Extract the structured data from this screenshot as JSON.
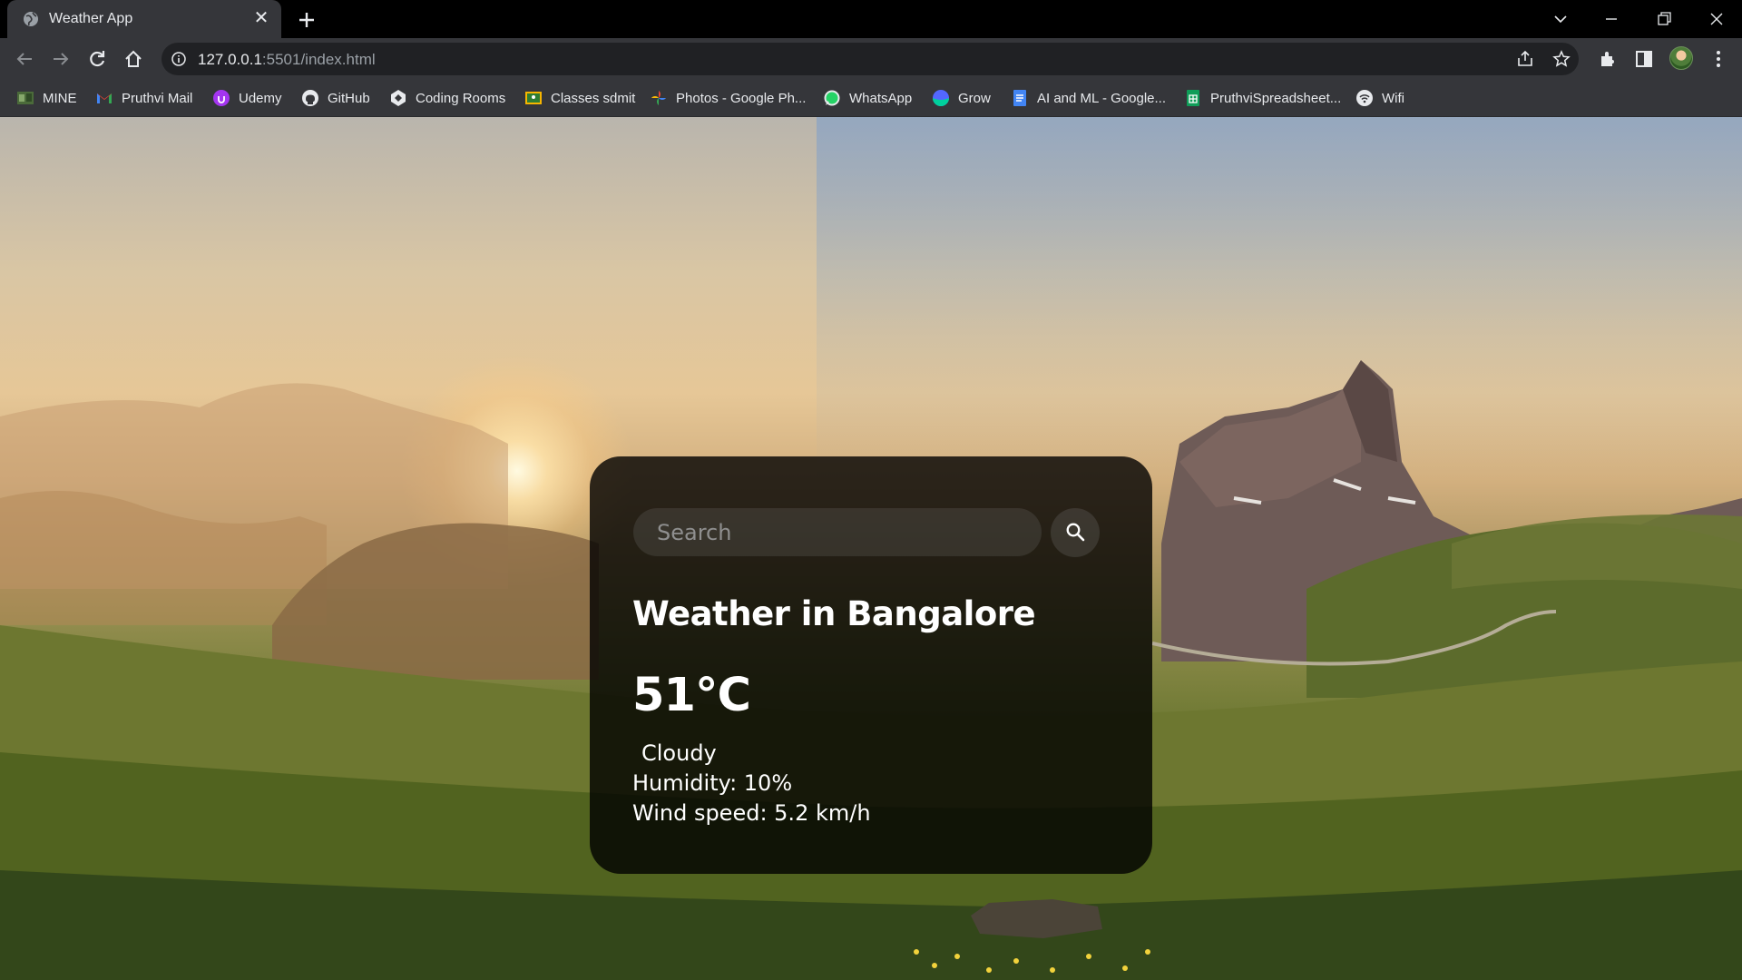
{
  "browser": {
    "tab": {
      "title": "Weather App",
      "close_glyph": "✕"
    },
    "url": {
      "host": "127.0.0.1",
      "rest": ":5501/index.html"
    },
    "bookmarks": [
      {
        "label": "MINE",
        "icon": "mine-icon"
      },
      {
        "label": "Pruthvi Mail",
        "icon": "gmail-icon"
      },
      {
        "label": "Udemy",
        "icon": "udemy-icon"
      },
      {
        "label": "GitHub",
        "icon": "github-icon"
      },
      {
        "label": "Coding Rooms",
        "icon": "coding-rooms-icon"
      },
      {
        "label": "Classes sdmit",
        "icon": "classroom-icon"
      },
      {
        "label": "Photos - Google Ph...",
        "icon": "google-photos-icon"
      },
      {
        "label": "WhatsApp",
        "icon": "whatsapp-icon"
      },
      {
        "label": "Grow",
        "icon": "grow-icon"
      },
      {
        "label": "AI and ML - Google...",
        "icon": "google-docs-icon"
      },
      {
        "label": "PruthviSpreadsheet...",
        "icon": "google-sheets-icon"
      },
      {
        "label": "Wifi",
        "icon": "wifi-icon"
      }
    ]
  },
  "weather": {
    "search": {
      "placeholder": "Search",
      "value": ""
    },
    "city_title": "Weather in Bangalore",
    "temperature": "51°C",
    "description": "Cloudy",
    "humidity": "Humidity: 10%",
    "wind": "Wind speed: 5.2 km/h"
  },
  "colors": {
    "chrome_dark": "#35363a",
    "omnibox": "#202124",
    "card_bg": "rgba(0,0,0,0.80)",
    "text": "#ffffff"
  }
}
